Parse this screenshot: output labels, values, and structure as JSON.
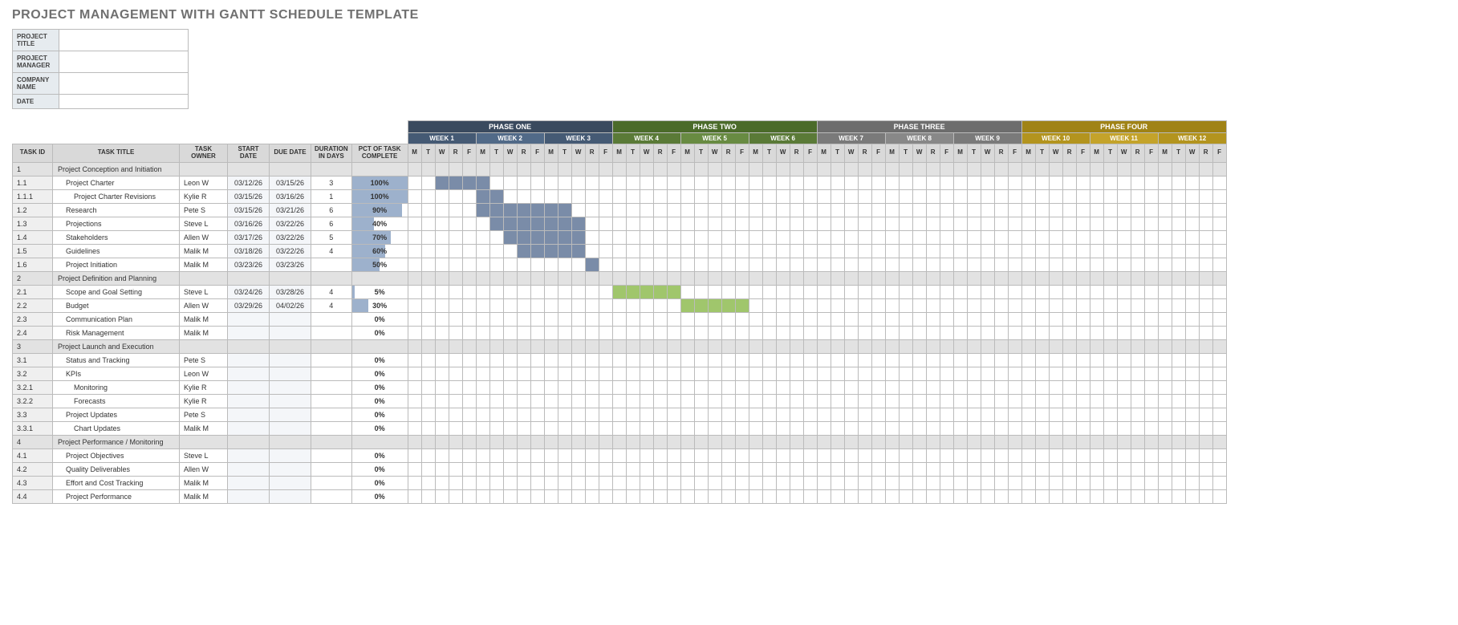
{
  "title": "PROJECT MANAGEMENT WITH GANTT SCHEDULE TEMPLATE",
  "meta_labels": [
    "PROJECT TITLE",
    "PROJECT MANAGER",
    "COMPANY NAME",
    "DATE"
  ],
  "meta_values": [
    "",
    "",
    "",
    ""
  ],
  "hdr": {
    "id": "TASK ID",
    "title": "TASK TITLE",
    "owner": "TASK OWNER",
    "sd": "START DATE",
    "dd": "DUE DATE",
    "dur": "DURATION IN DAYS",
    "pct": "PCT OF TASK COMPLETE"
  },
  "phases": [
    {
      "name": "PHASE ONE",
      "weeks": [
        "WEEK 1",
        "WEEK 2",
        "WEEK 3"
      ],
      "cls": "1"
    },
    {
      "name": "PHASE TWO",
      "weeks": [
        "WEEK 4",
        "WEEK 5",
        "WEEK 6"
      ],
      "cls": "2"
    },
    {
      "name": "PHASE THREE",
      "weeks": [
        "WEEK 7",
        "WEEK 8",
        "WEEK 9"
      ],
      "cls": "3"
    },
    {
      "name": "PHASE FOUR",
      "weeks": [
        "WEEK 10",
        "WEEK 11",
        "WEEK 12"
      ],
      "cls": "4"
    }
  ],
  "days": [
    "M",
    "T",
    "W",
    "R",
    "F"
  ],
  "shaded_weeks": {
    "1": [
      1
    ],
    "2": [
      1
    ],
    "3": [],
    "4": [
      1,
      2
    ]
  },
  "rows": [
    {
      "sec": true,
      "id": "1",
      "title": "Project Conception and Initiation"
    },
    {
      "id": "1.1",
      "title": "Project Charter",
      "indent": 1,
      "owner": "Leon W",
      "sd": "03/12/26",
      "dd": "03/15/26",
      "dur": "3",
      "pct": 100,
      "bar": {
        "phase": 1,
        "wk": 1,
        "d": 3,
        "len": 4
      }
    },
    {
      "id": "1.1.1",
      "title": "Project Charter Revisions",
      "indent": 2,
      "owner": "Kylie R",
      "sd": "03/15/26",
      "dd": "03/16/26",
      "dur": "1",
      "pct": 100,
      "bar": {
        "phase": 1,
        "wk": 2,
        "d": 1,
        "len": 2
      }
    },
    {
      "id": "1.2",
      "title": "Research",
      "indent": 1,
      "owner": "Pete S",
      "sd": "03/15/26",
      "dd": "03/21/26",
      "dur": "6",
      "pct": 90,
      "bar": {
        "phase": 1,
        "wk": 2,
        "d": 1,
        "len": 7
      }
    },
    {
      "id": "1.3",
      "title": "Projections",
      "indent": 1,
      "owner": "Steve L",
      "sd": "03/16/26",
      "dd": "03/22/26",
      "dur": "6",
      "pct": 40,
      "bar": {
        "phase": 1,
        "wk": 2,
        "d": 2,
        "len": 7
      }
    },
    {
      "id": "1.4",
      "title": "Stakeholders",
      "indent": 1,
      "owner": "Allen W",
      "sd": "03/17/26",
      "dd": "03/22/26",
      "dur": "5",
      "pct": 70,
      "bar": {
        "phase": 1,
        "wk": 2,
        "d": 3,
        "len": 6
      }
    },
    {
      "id": "1.5",
      "title": "Guidelines",
      "indent": 1,
      "owner": "Malik M",
      "sd": "03/18/26",
      "dd": "03/22/26",
      "dur": "4",
      "pct": 60,
      "bar": {
        "phase": 1,
        "wk": 2,
        "d": 4,
        "len": 5
      }
    },
    {
      "id": "1.6",
      "title": "Project Initiation",
      "indent": 1,
      "owner": "Malik M",
      "sd": "03/23/26",
      "dd": "03/23/26",
      "dur": "",
      "pct": 50,
      "bar": {
        "phase": 1,
        "wk": 3,
        "d": 4,
        "len": 1
      }
    },
    {
      "sec": true,
      "id": "2",
      "title": "Project Definition and Planning"
    },
    {
      "id": "2.1",
      "title": "Scope and Goal Setting",
      "indent": 1,
      "owner": "Steve L",
      "sd": "03/24/26",
      "dd": "03/28/26",
      "dur": "4",
      "pct": 5,
      "bar": {
        "phase": 2,
        "wk": 0,
        "d": 0,
        "len": 5
      }
    },
    {
      "id": "2.2",
      "title": "Budget",
      "indent": 1,
      "owner": "Allen W",
      "sd": "03/29/26",
      "dd": "04/02/26",
      "dur": "4",
      "pct": 30,
      "bar": {
        "phase": 2,
        "wk": 1,
        "d": 0,
        "len": 5
      }
    },
    {
      "id": "2.3",
      "title": "Communication Plan",
      "indent": 1,
      "owner": "Malik M",
      "sd": "",
      "dd": "",
      "dur": "",
      "pct": 0
    },
    {
      "id": "2.4",
      "title": "Risk Management",
      "indent": 1,
      "owner": "Malik M",
      "sd": "",
      "dd": "",
      "dur": "",
      "pct": 0
    },
    {
      "sec": true,
      "id": "3",
      "title": "Project Launch and Execution"
    },
    {
      "id": "3.1",
      "title": "Status and Tracking",
      "indent": 1,
      "owner": "Pete S",
      "pct": 0
    },
    {
      "id": "3.2",
      "title": "KPIs",
      "indent": 1,
      "owner": "Leon W",
      "pct": 0
    },
    {
      "id": "3.2.1",
      "title": "Monitoring",
      "indent": 2,
      "owner": "Kylie R",
      "pct": 0
    },
    {
      "id": "3.2.2",
      "title": "Forecasts",
      "indent": 2,
      "owner": "Kylie R",
      "pct": 0
    },
    {
      "id": "3.3",
      "title": "Project Updates",
      "indent": 1,
      "owner": "Pete S",
      "pct": 0
    },
    {
      "id": "3.3.1",
      "title": "Chart Updates",
      "indent": 2,
      "owner": "Malik M",
      "pct": 0
    },
    {
      "sec": true,
      "id": "4",
      "title": "Project Performance / Monitoring"
    },
    {
      "id": "4.1",
      "title": "Project Objectives",
      "indent": 1,
      "owner": "Steve L",
      "pct": 0
    },
    {
      "id": "4.2",
      "title": "Quality Deliverables",
      "indent": 1,
      "owner": "Allen W",
      "pct": 0
    },
    {
      "id": "4.3",
      "title": "Effort and Cost Tracking",
      "indent": 1,
      "owner": "Malik M",
      "pct": 0
    },
    {
      "id": "4.4",
      "title": "Project Performance",
      "indent": 1,
      "owner": "Malik M",
      "pct": 0
    }
  ]
}
